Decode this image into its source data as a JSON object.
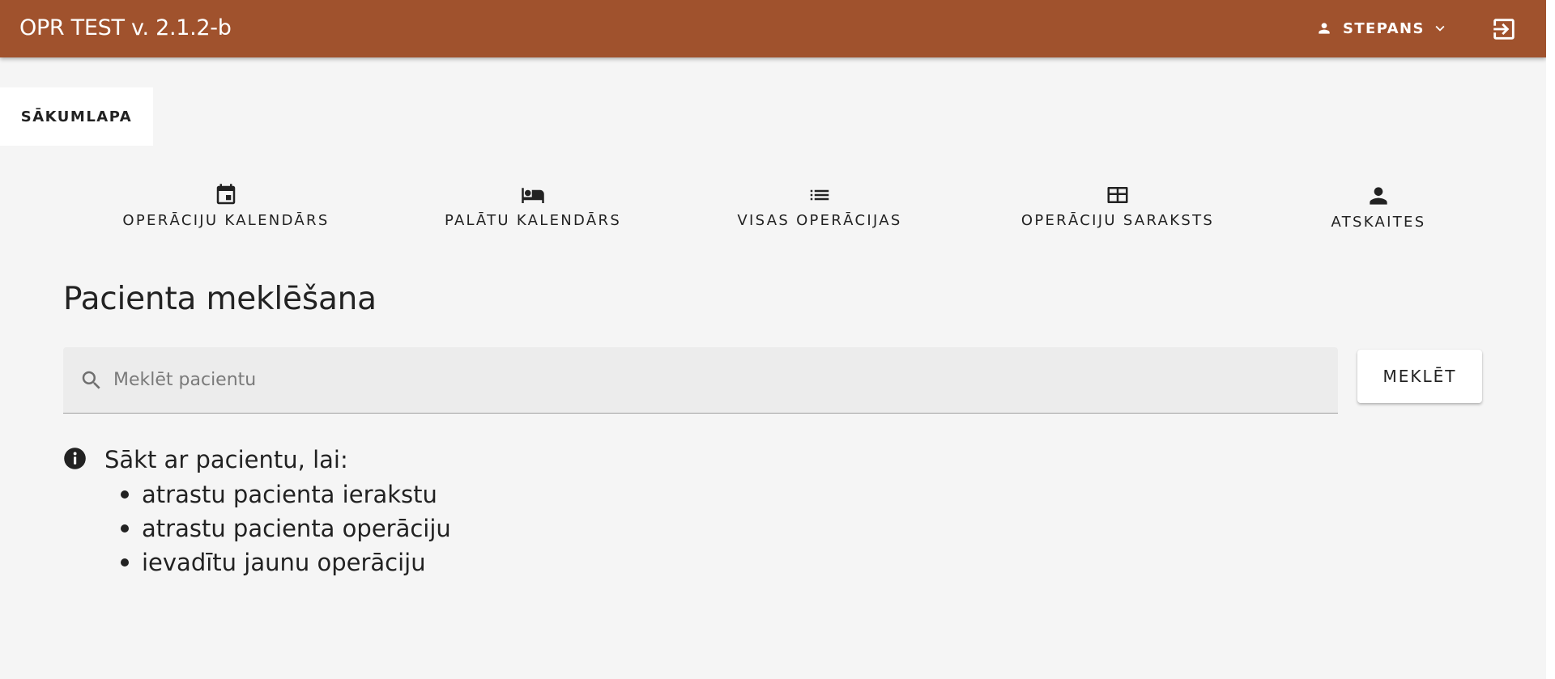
{
  "app": {
    "title": "OPR TEST v. 2.1.2-b"
  },
  "header": {
    "user_icon": "person-icon",
    "user_name": "STEPANS",
    "user_menu_icon": "chevron-down-icon",
    "logout_icon": "logout-icon"
  },
  "tabs": [
    {
      "label": "SĀKUMLAPA",
      "active": true
    }
  ],
  "nav": [
    {
      "label": "OPERĀCIJU KALENDĀRS",
      "icon": "calendar-icon"
    },
    {
      "label": "PALĀTU KALENDĀRS",
      "icon": "bed-icon"
    },
    {
      "label": "VISAS OPERĀCIJAS",
      "icon": "list-icon"
    },
    {
      "label": "OPERĀCIJU SARAKSTS",
      "icon": "table-icon"
    },
    {
      "label": "ATSKAITES",
      "icon": "person-icon"
    }
  ],
  "search": {
    "title": "Pacienta meklēšana",
    "placeholder": "Meklēt pacientu",
    "value": "",
    "button_label": "MEKLĒT",
    "icon": "search-icon"
  },
  "info": {
    "icon": "info-icon",
    "heading": "Sākt ar pacientu, lai:",
    "items": [
      "atrastu pacienta ierakstu",
      "atrastu pacienta operāciju",
      "ievadītu jaunu operāciju"
    ]
  },
  "colors": {
    "appbar": "#a0522d",
    "background": "#f5f5f5",
    "text": "#222222"
  }
}
